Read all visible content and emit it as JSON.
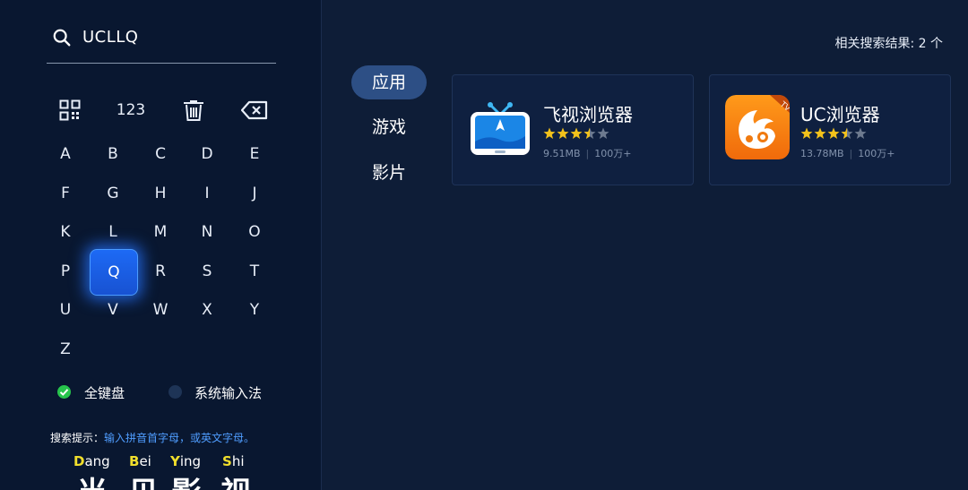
{
  "search": {
    "query": "UCLLQ"
  },
  "keyboard": {
    "func_keys": {
      "numeric_label": "123",
      "icons": [
        "qr-icon",
        "trash-icon",
        "backspace-icon"
      ]
    },
    "rows": [
      [
        "A",
        "B",
        "C",
        "D",
        "E"
      ],
      [
        "F",
        "G",
        "H",
        "I",
        "J"
      ],
      [
        "K",
        "L",
        "M",
        "N",
        "O"
      ],
      [
        "P",
        "Q",
        "R",
        "S",
        "T"
      ],
      [
        "U",
        "V",
        "W",
        "X",
        "Y"
      ],
      [
        "Z"
      ]
    ],
    "focused_key": "Q"
  },
  "input_modes": [
    {
      "label": "全键盘",
      "selected": true
    },
    {
      "label": "系统输入法",
      "selected": false
    }
  ],
  "hint": {
    "label": "搜索提示：",
    "text": "输入拼音首字母，或英文字母。"
  },
  "example": [
    {
      "initial": "D",
      "rest": "ang",
      "char": "当"
    },
    {
      "initial": "B",
      "rest": "ei",
      "char": "贝"
    },
    {
      "initial": "Y",
      "rest": "ing",
      "char": "影"
    },
    {
      "initial": "S",
      "rest": "hi",
      "char": "视"
    }
  ],
  "results": {
    "count_text": "相关搜索结果: 2 个"
  },
  "categories": [
    {
      "label": "应用",
      "active": true
    },
    {
      "label": "游戏",
      "active": false
    },
    {
      "label": "影片",
      "active": false
    }
  ],
  "apps": [
    {
      "name": "飞视浏览器",
      "rating": 3.5,
      "size": "9.51MB",
      "downloads": "100万+",
      "icon": "feishi-browser-icon"
    },
    {
      "name": "UC浏览器",
      "rating": 3.5,
      "size": "13.78MB",
      "downloads": "100万+",
      "icon": "uc-browser-icon"
    }
  ],
  "colors": {
    "accent": "#1d6af5",
    "star": "#f3c21b",
    "hint": "#4f9dff",
    "pinyin_initial": "#f1df2c",
    "check": "#27c44c"
  }
}
